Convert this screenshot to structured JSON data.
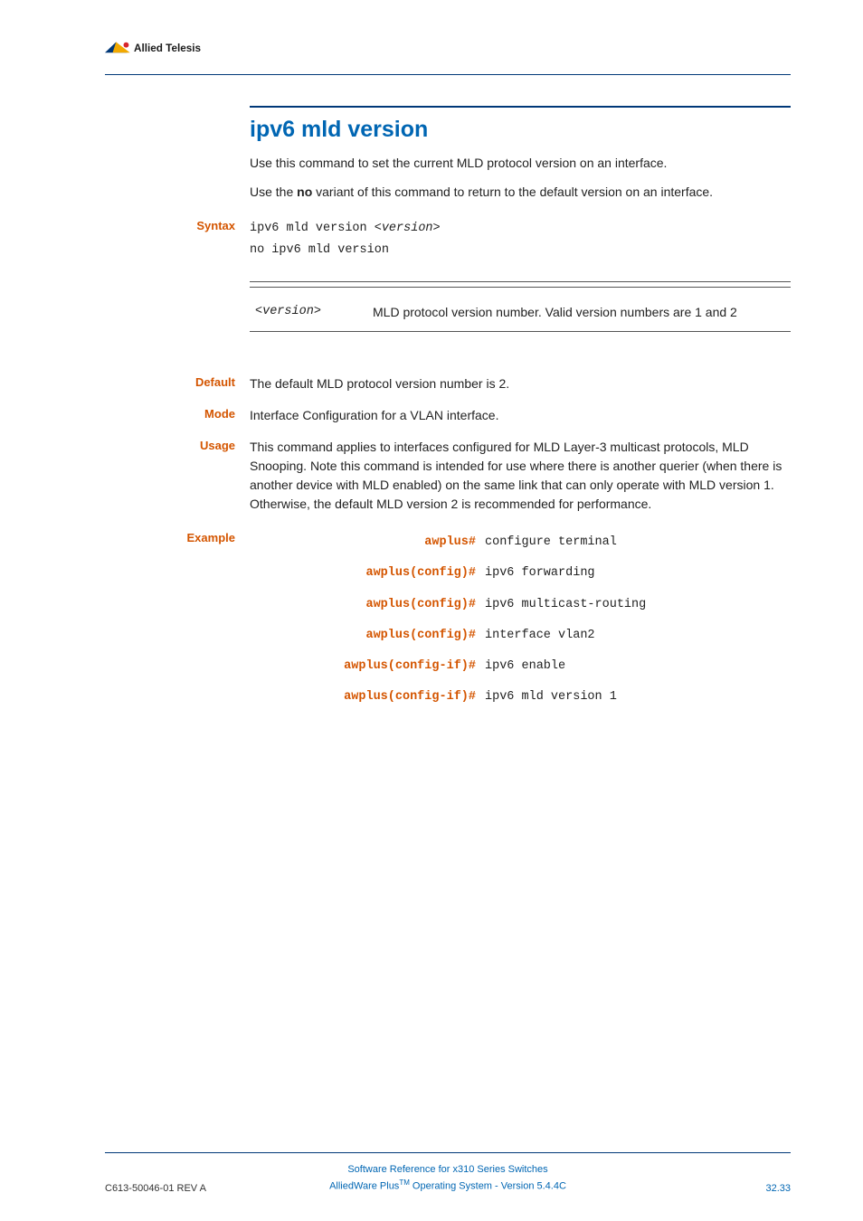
{
  "header": {
    "brand": "Allied Telesis"
  },
  "command": {
    "title": "ipv6 mld version",
    "intro1_pre": "Use this command to set the current MLD protocol version on an interface.",
    "intro2_pre": "Use the ",
    "intro2_bold": "no",
    "intro2_post": " variant of this command to return to the default version on an interface."
  },
  "syntax": {
    "label": "Syntax",
    "line1_pre": "ipv6 mld version <",
    "line1_var": "version",
    "line1_post": ">",
    "line2": "no ipv6 mld version"
  },
  "param": {
    "name_pre": "<",
    "name_var": "version",
    "name_post": ">",
    "desc": "MLD protocol version number. Valid version numbers are 1 and 2"
  },
  "default": {
    "label": "Default",
    "text": "The default MLD protocol version number is 2."
  },
  "mode": {
    "label": "Mode",
    "text": "Interface Configuration for a VLAN interface."
  },
  "usage": {
    "label": "Usage",
    "text": "This command applies to interfaces configured for MLD Layer-3 multicast protocols, MLD Snooping. Note this command is intended for use where there is another querier (when there is another device with MLD enabled) on the same link that can only operate with MLD version 1. Otherwise, the default MLD version 2 is recommended for performance."
  },
  "example": {
    "label": "Example",
    "rows": [
      {
        "prompt": "awplus#",
        "cmd": "configure terminal"
      },
      {
        "prompt": "awplus(config)#",
        "cmd": "ipv6 forwarding"
      },
      {
        "prompt": "awplus(config)#",
        "cmd": "ipv6 multicast-routing"
      },
      {
        "prompt": "awplus(config)#",
        "cmd": "interface vlan2"
      },
      {
        "prompt": "awplus(config-if)#",
        "cmd": "ipv6 enable"
      },
      {
        "prompt": "awplus(config-if)#",
        "cmd": "ipv6 mld version 1"
      }
    ]
  },
  "footer": {
    "left": "C613-50046-01 REV A",
    "center1": "Software Reference for x310 Series Switches",
    "center2_pre": "AlliedWare Plus",
    "center2_sup": "TM",
    "center2_post": " Operating System - Version 5.4.4C",
    "right": "32.33"
  }
}
